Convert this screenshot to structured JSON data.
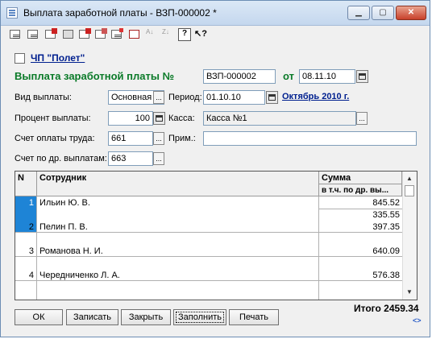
{
  "window": {
    "title": "Выплата заработной платы - ВЗП-000002 *",
    "controls": {
      "minimize": "▁",
      "maximize": "▢",
      "close": "✕"
    }
  },
  "toolbar": {
    "icons": [
      "new-icon",
      "copy-icon",
      "delete-icon",
      "view-icon",
      "mark-delete-icon",
      "unmark-icon",
      "post-icon",
      "hierarchy-icon",
      "sort-asc-icon",
      "sort-desc-icon",
      "help-icon",
      "context-help-icon"
    ]
  },
  "header": {
    "company": "ЧП \"Полет\"",
    "doc_title": "Выплата заработной платы №",
    "doc_number": "ВЗП-000002",
    "date_label": "от",
    "date": "08.11.10"
  },
  "form": {
    "payment_type_label": "Вид выплаты:",
    "payment_type": "Основная з/п",
    "period_label": "Период:",
    "period": "01.10.10",
    "period_link": "Октябрь 2010 г.",
    "percent_label": "Процент выплаты:",
    "percent": "100",
    "cash_label": "Касса:",
    "cash": "Касса №1",
    "labor_account_label": "Счет оплаты труда:",
    "labor_account": "661",
    "note_label": "Прим.:",
    "note": "",
    "other_account_label": "Счет по др. выплатам:",
    "other_account": "663"
  },
  "table": {
    "columns": {
      "n": "N",
      "employee": "Сотрудник",
      "sum": "Сумма",
      "sum_other": "в т.ч. по др. вы..."
    },
    "rows": [
      {
        "n": "1",
        "employee": "Ильин Ю. В.",
        "sum": "845.52",
        "sum_other": "335.55"
      },
      {
        "n": "2",
        "employee": "Пелин П. В.",
        "sum": "397.35",
        "sum_other": ""
      },
      {
        "n": "3",
        "employee": "Романова Н. И.",
        "sum": "640.09",
        "sum_other": ""
      },
      {
        "n": "4",
        "employee": "Чередниченко Л. А.",
        "sum": "576.38",
        "sum_other": ""
      }
    ]
  },
  "footer": {
    "total": "Итого 2459.34",
    "buttons": {
      "ok": "ОК",
      "save": "Записать",
      "close": "Закрыть",
      "fill": "Заполнить",
      "print": "Печать"
    },
    "nav_arrows": "<>"
  }
}
